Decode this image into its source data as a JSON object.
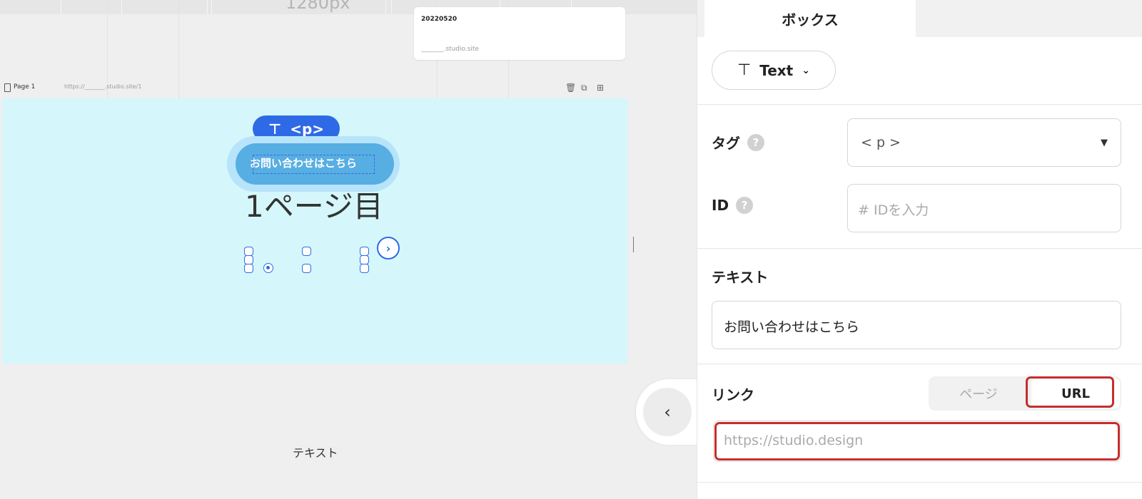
{
  "ruler": {
    "label": "1280px"
  },
  "page_card": {
    "date": "20220520",
    "site": "_______.studio.site"
  },
  "page_bar": {
    "name": "Page 1",
    "url": "https://_______.studio.site/1",
    "tools": [
      "🗑",
      "⧉",
      "⊞"
    ]
  },
  "canvas": {
    "heading": "1ページ目",
    "tag_badge": {
      "icon": "⊤",
      "label": "<p>"
    },
    "button_text": "お問い合わせはこちら",
    "arrow_glyph": "›",
    "bottom_label": "テキスト",
    "collapse_glyph": "‹"
  },
  "panel": {
    "tab": "ボックス",
    "type": {
      "icon": "⊤",
      "label": "Text",
      "chevron": "⌄"
    },
    "tag": {
      "label": "タグ",
      "help": "?",
      "value": "< p >",
      "caret": "▼"
    },
    "id": {
      "label": "ID",
      "help": "?",
      "placeholder": "# IDを入力"
    },
    "text": {
      "label": "テキスト",
      "value": "お問い合わせはこちら"
    },
    "link": {
      "label": "リンク",
      "option_page": "ページ",
      "option_url": "URL",
      "placeholder": "https://studio.design"
    }
  },
  "colors": {
    "accent": "#2f6ae6",
    "page_bg": "#d5f7fb",
    "button": "#57aee2",
    "highlight": "#c62d2d"
  }
}
